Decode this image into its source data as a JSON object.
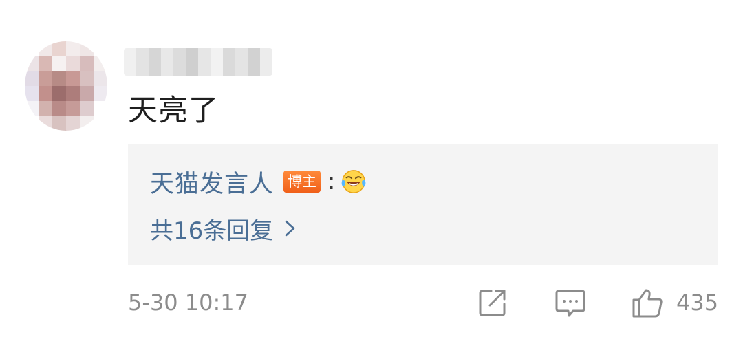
{
  "comment": {
    "text": "天亮了",
    "timestamp": "5-30 10:17",
    "like_count": "435"
  },
  "reply_preview": {
    "author": "天猫发言人",
    "author_badge": "博主",
    "separator": ":",
    "emoji": "laugh-cry-emoji",
    "count_label": "共16条回复",
    "chevron": "chevron-right-icon"
  },
  "icons": {
    "share": "share-icon",
    "comment": "comment-icon",
    "like": "thumbs-up-icon"
  },
  "colors": {
    "link_blue": "#4a6e95",
    "meta_gray": "#8c8c8c",
    "badge_orange": "#f0601a",
    "reply_bg": "#f4f4f4"
  }
}
